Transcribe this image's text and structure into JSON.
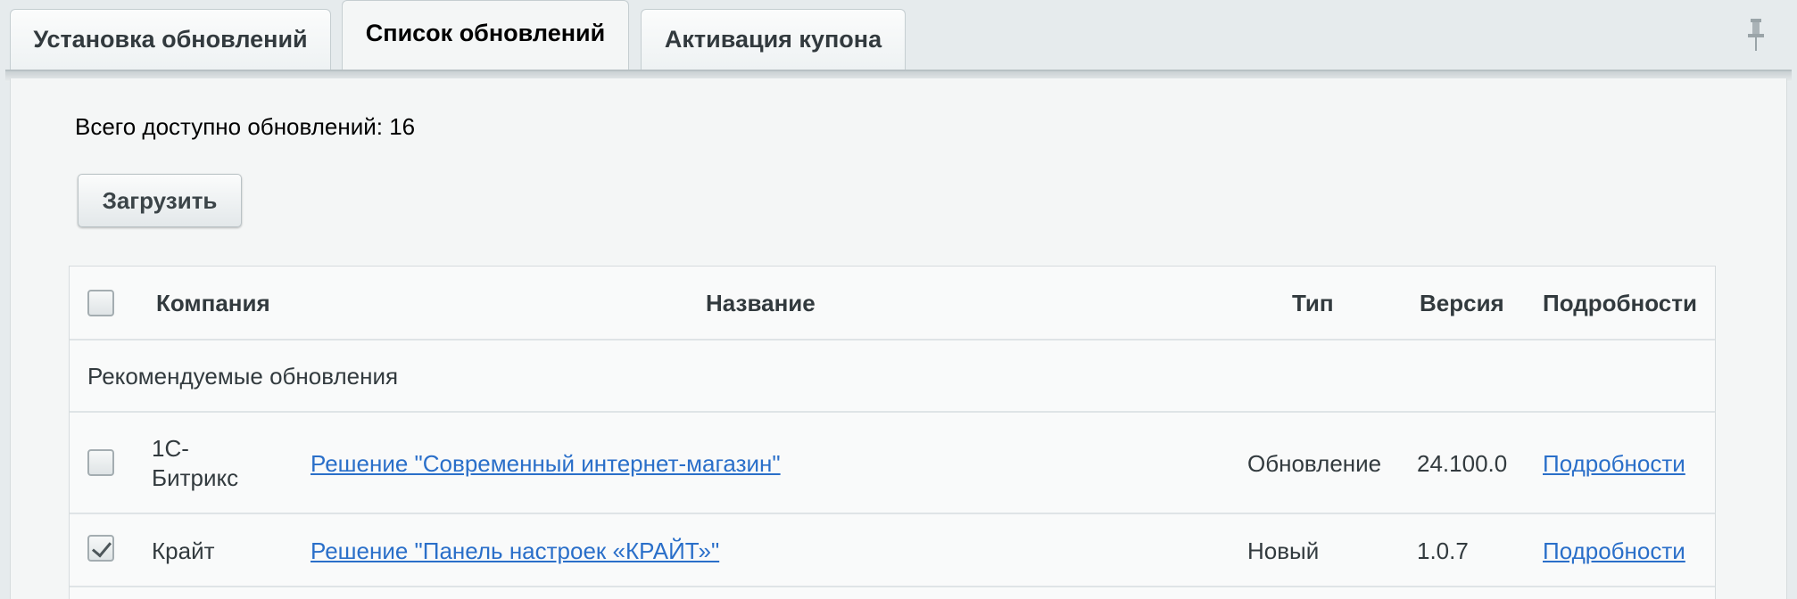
{
  "tabs": [
    {
      "label": "Установка обновлений",
      "active": false
    },
    {
      "label": "Список обновлений",
      "active": true
    },
    {
      "label": "Активация купона",
      "active": false
    }
  ],
  "pin_icon": "pin-icon",
  "summary": {
    "total_text": "Всего доступно обновлений: 16"
  },
  "toolbar": {
    "load_label": "Загрузить"
  },
  "table": {
    "columns": {
      "company": "Компания",
      "name": "Название",
      "type": "Тип",
      "version": "Версия",
      "details": "Подробности"
    },
    "group_label": "Рекомендуемые обновления",
    "rows": [
      {
        "checked": false,
        "company_line1": "1С-",
        "company_line2": "Битрикс",
        "name": "Решение \"Современный интернет-магазин\"",
        "type": "Обновление",
        "version": "24.100.0",
        "details": "Подробности"
      },
      {
        "checked": true,
        "company": "Крайт",
        "name": "Решение \"Панель настроек «КРАЙТ»\"",
        "type": "Новый",
        "version": "1.0.7",
        "details": "Подробности"
      }
    ]
  },
  "colors": {
    "link": "#2a6fc9",
    "background": "#e6ebed",
    "panel": "#f4f6f6"
  }
}
